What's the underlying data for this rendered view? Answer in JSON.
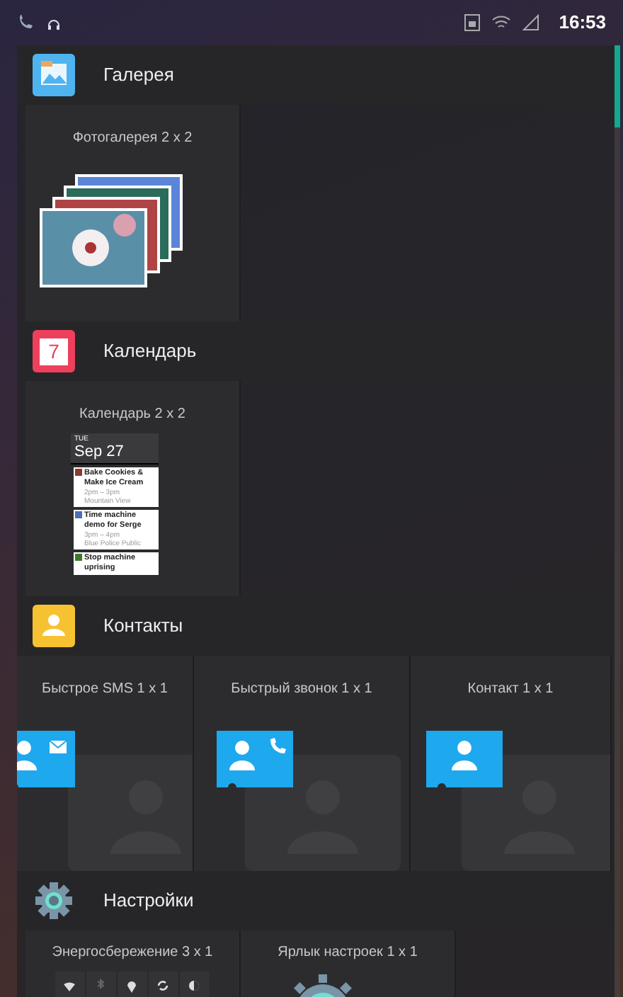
{
  "status_bar": {
    "time": "16:53"
  },
  "sections": [
    {
      "kind": "gallery",
      "title": "Галерея",
      "widgets": [
        {
          "kind": "photos",
          "label": "Фотогалерея 2 x 2"
        }
      ]
    },
    {
      "kind": "calendar",
      "title": "Календарь",
      "icon_text": "7",
      "widgets": [
        {
          "kind": "agenda",
          "label": "Календарь 2 x 2",
          "day": "TUE",
          "date": "Sep 27",
          "events": [
            {
              "title": "Bake Cookies & Make Ice Cream",
              "time": "2pm – 3pm",
              "place": "Mountain View",
              "color": "#8b3a2e"
            },
            {
              "title": "Time machine demo for Serge",
              "time": "3pm – 4pm",
              "place": "Blue Police Public",
              "color": "#4a6fb5"
            },
            {
              "title": "Stop machine uprising",
              "color": "#3b7a2b"
            }
          ]
        }
      ]
    },
    {
      "kind": "contacts",
      "title": "Контакты",
      "widgets": [
        {
          "kind": "sms",
          "label": "Быстрое SMS 1 x 1"
        },
        {
          "kind": "call",
          "label": "Быстрый звонок 1 x 1"
        },
        {
          "kind": "contact",
          "label": "Контакт 1 x 1"
        }
      ]
    },
    {
      "kind": "settings",
      "title": "Настройки",
      "widgets": [
        {
          "kind": "power",
          "label": "Энергосбережение 3 x 1"
        },
        {
          "kind": "shortcut",
          "label": "Ярлык настроек 1 x 1"
        }
      ]
    }
  ]
}
